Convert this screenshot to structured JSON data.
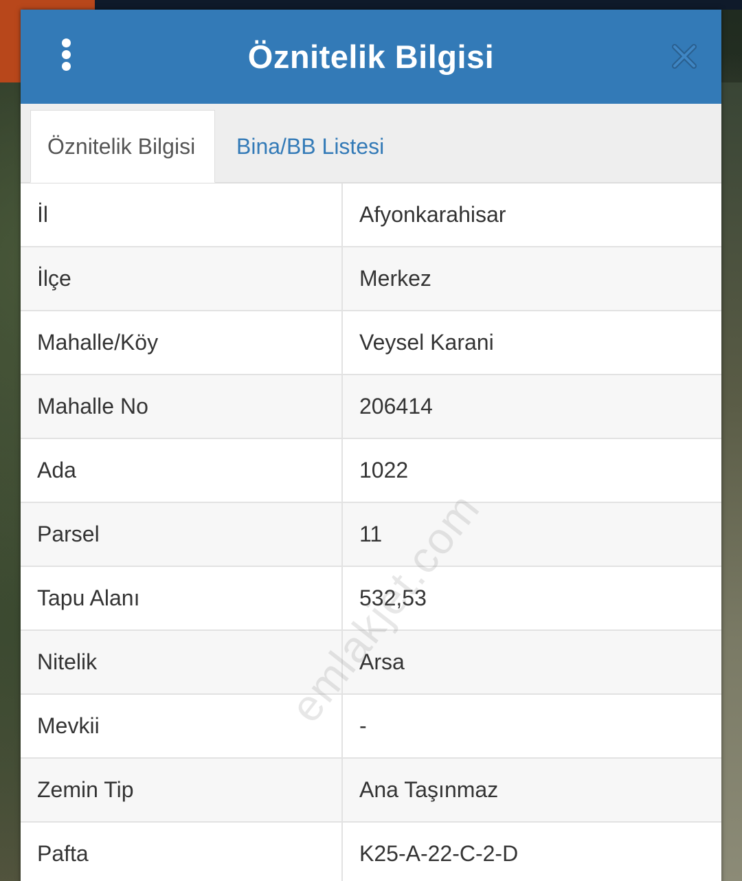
{
  "dialog": {
    "title": "Öznitelik Bilgisi",
    "menu_icon": "more-vertical-icon",
    "close_icon": "close-icon",
    "accent_color": "#337ab7"
  },
  "tabs": [
    {
      "label": "Öznitelik Bilgisi",
      "active": true
    },
    {
      "label": "Bina/BB Listesi",
      "active": false
    }
  ],
  "attributes": [
    {
      "key": "İl",
      "value": "Afyonkarahisar"
    },
    {
      "key": "İlçe",
      "value": "Merkez"
    },
    {
      "key": "Mahalle/Köy",
      "value": "Veysel Karani"
    },
    {
      "key": "Mahalle No",
      "value": "206414"
    },
    {
      "key": "Ada",
      "value": "1022"
    },
    {
      "key": "Parsel",
      "value": "11"
    },
    {
      "key": "Tapu Alanı",
      "value": "532,53"
    },
    {
      "key": "Nitelik",
      "value": "Arsa"
    },
    {
      "key": "Mevkii",
      "value": "-"
    },
    {
      "key": "Zemin Tip",
      "value": "Ana Taşınmaz"
    },
    {
      "key": "Pafta",
      "value": "K25-A-22-C-2-D"
    }
  ],
  "watermark": "emlakjet.com"
}
